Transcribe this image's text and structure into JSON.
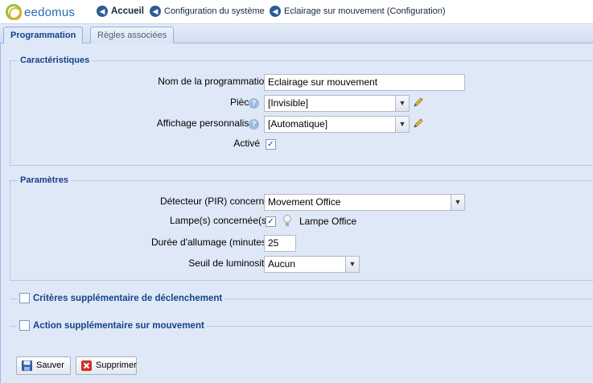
{
  "logo": {
    "text": "eedomus"
  },
  "breadcrumb": {
    "home": "Accueil",
    "system": "Configuration du système",
    "current": "Eclairage sur mouvement (Configuration)"
  },
  "tabs": [
    {
      "label": "Programmation",
      "active": true
    },
    {
      "label": "Règles associées",
      "active": false
    }
  ],
  "characteristics": {
    "legend": "Caractéristiques",
    "name_label": "Nom de la programmation",
    "name_value": "Eclairage sur mouvement",
    "room_label": "Pièce",
    "room_value": "[Invisible]",
    "display_label": "Affichage personnalisé",
    "display_value": "[Automatique]",
    "active_label": "Activé",
    "active_checked": true
  },
  "parameters": {
    "legend": "Paramètres",
    "detector_label": "Détecteur (PIR) concerné",
    "detector_value": "Movement Office",
    "lamps_label": "Lampe(s) concernée(s)",
    "lamp_checked": true,
    "lamp_name": "Lampe Office",
    "duration_label": "Durée d'allumage (minutes)",
    "duration_value": "25",
    "threshold_label": "Seuil de luminosité",
    "threshold_value": "Aucun"
  },
  "extra_criteria": {
    "label": "Critères supplémentaire de déclenchement",
    "checked": false
  },
  "extra_action": {
    "label": "Action supplémentaire sur mouvement",
    "checked": false
  },
  "buttons": {
    "save": "Sauver",
    "delete": "Supprimer"
  },
  "colors": {
    "panel_bg": "#dfe8f6",
    "accent": "#15428b",
    "border": "#99bbe8"
  }
}
